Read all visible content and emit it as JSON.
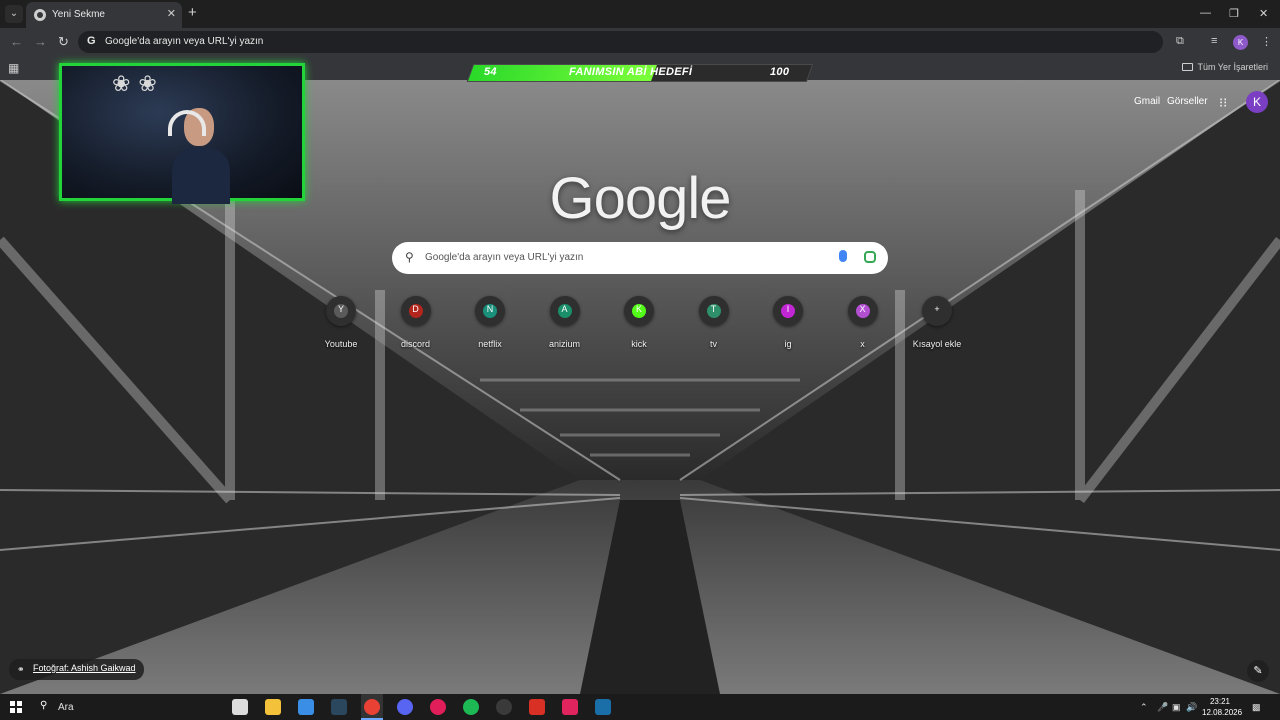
{
  "browser": {
    "tab_title": "Yeni Sekme",
    "omnibox_placeholder": "Google'da arayın veya URL'yi yazın",
    "profile_initial": "K",
    "bookmarks_folder": "Tüm Yer İşaretleri"
  },
  "stream_goal": {
    "current": "54",
    "label": "FANIMSIN ABİ HEDEFİ",
    "target": "100",
    "progress_fraction": 0.54
  },
  "ntp": {
    "links": {
      "gmail": "Gmail",
      "images": "Görseller"
    },
    "profile_initial": "K",
    "logo": "Google",
    "search_placeholder": "Google'da arayın veya URL'yi yazın",
    "shortcuts": [
      {
        "label": "Youtube",
        "letter": "Y",
        "color": "#5a5a5a"
      },
      {
        "label": "discord",
        "letter": "D",
        "color": "#b3261e"
      },
      {
        "label": "netflix",
        "letter": "N",
        "color": "#1a8f7a"
      },
      {
        "label": "anizium",
        "letter": "A",
        "color": "#1a8f6a"
      },
      {
        "label": "kick",
        "letter": "K",
        "color": "#53fc18"
      },
      {
        "label": "tv",
        "letter": "T",
        "color": "#2f8f6a"
      },
      {
        "label": "ig",
        "letter": "I",
        "color": "#c026d3"
      },
      {
        "label": "x",
        "letter": "X",
        "color": "#b34fd1"
      },
      {
        "label": "Kısayol ekle",
        "letter": "+",
        "color": "#2f2f2f"
      }
    ],
    "credit": "Fotoğraf: Ashish Gaikwad"
  },
  "taskbar": {
    "search_label": "Ara",
    "time": "23:21",
    "date": "12.08.2026",
    "apps": [
      {
        "name": "task-view",
        "color": "#dcdcdc"
      },
      {
        "name": "file-explorer",
        "color": "#f3c13a"
      },
      {
        "name": "store",
        "color": "#3a8ee6"
      },
      {
        "name": "steam",
        "color": "#2a475e"
      },
      {
        "name": "chrome",
        "color": "#e94235"
      },
      {
        "name": "discord",
        "color": "#5865f2"
      },
      {
        "name": "media",
        "color": "#e01e5a"
      },
      {
        "name": "spotify",
        "color": "#1db954"
      },
      {
        "name": "obs",
        "color": "#3a3a3a"
      },
      {
        "name": "recorder",
        "color": "#d93025"
      },
      {
        "name": "tool",
        "color": "#e0245e"
      },
      {
        "name": "steam-2",
        "color": "#1b6fa8"
      }
    ]
  }
}
